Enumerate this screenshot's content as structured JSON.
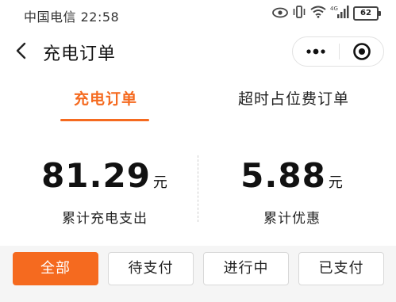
{
  "status_bar": {
    "carrier": "中国电信",
    "time": "22:58",
    "network": "4G",
    "battery": "62",
    "icons": [
      "eye-icon",
      "vibrate-icon",
      "wifi-icon",
      "signal-icon",
      "battery-icon"
    ]
  },
  "nav": {
    "title": "充电订单",
    "back_icon": "chevron-left-icon",
    "more_icon": "more-dots-icon",
    "close_icon": "target-close-icon"
  },
  "tabs": {
    "items": [
      {
        "label": "充电订单",
        "active": true
      },
      {
        "label": "超时占位费订单",
        "active": false
      }
    ]
  },
  "stats": {
    "total_spend": {
      "value": "81.29",
      "unit": "元",
      "label": "累计充电支出"
    },
    "total_discount": {
      "value": "5.88",
      "unit": "元",
      "label": "累计优惠"
    }
  },
  "filters": {
    "items": [
      {
        "label": "全部",
        "active": true
      },
      {
        "label": "待支付",
        "active": false
      },
      {
        "label": "进行中",
        "active": false
      },
      {
        "label": "已支付",
        "active": false
      }
    ]
  },
  "colors": {
    "accent": "#f56a1f",
    "background": "#f5f5f5"
  }
}
